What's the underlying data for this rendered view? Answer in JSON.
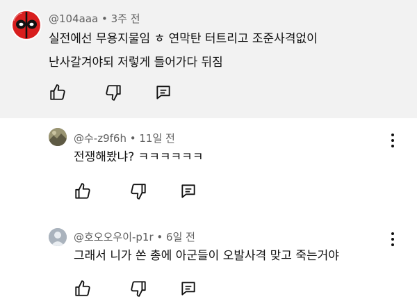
{
  "comments": [
    {
      "handle": "@104aaa",
      "time": "3주 전",
      "line1": "실전에선 무용지물임 ㅎ 연막탄  터트리고 조준사격없이",
      "line2": "난사갈겨야되 저렇게 들어가다 뒤짐"
    }
  ],
  "replies": [
    {
      "handle": "@수-z9f6h",
      "time": "11일 전",
      "text": "전쟁해봤냐? ㅋㅋㅋㅋㅋㅋ"
    },
    {
      "handle": "@호오오우이-p1r",
      "time": "6일 전",
      "text": "그래서 니가 쏜 총에 아군들이 오발사격 맞고 죽는거야"
    }
  ],
  "separator": " • ",
  "icons": [
    "thumbs-up-icon",
    "thumbs-down-icon",
    "reply-icon",
    "more-vert-icon"
  ],
  "colors": {
    "parent_bg": "#f2f2f2",
    "meta": "#606060",
    "text": "#0f0f0f",
    "thread_line": "#d9d9d9"
  }
}
